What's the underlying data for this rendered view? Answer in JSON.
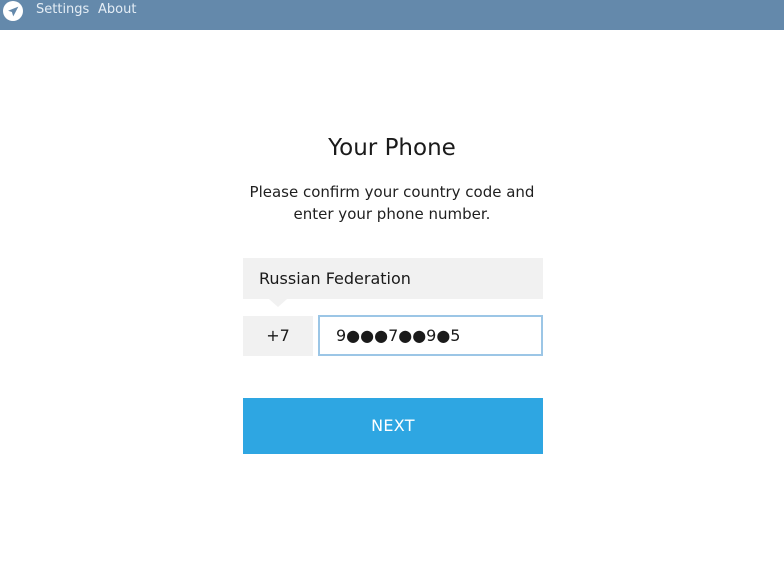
{
  "menu": {
    "logo_icon": "telegram-paper-plane-icon",
    "settings_label": "Settings",
    "about_label": "About"
  },
  "login": {
    "title": "Your Phone",
    "description": "Please confirm your country code and enter your phone number.",
    "country": "Russian Federation",
    "country_code": "+7",
    "phone_value": "9●●●7●●9●5",
    "next_label": "NEXT"
  },
  "colors": {
    "topbar": "#6489ab",
    "accent": "#2ea6e2",
    "field_bg": "#f1f1f1",
    "input_border_focus": "#9cc6e6"
  }
}
